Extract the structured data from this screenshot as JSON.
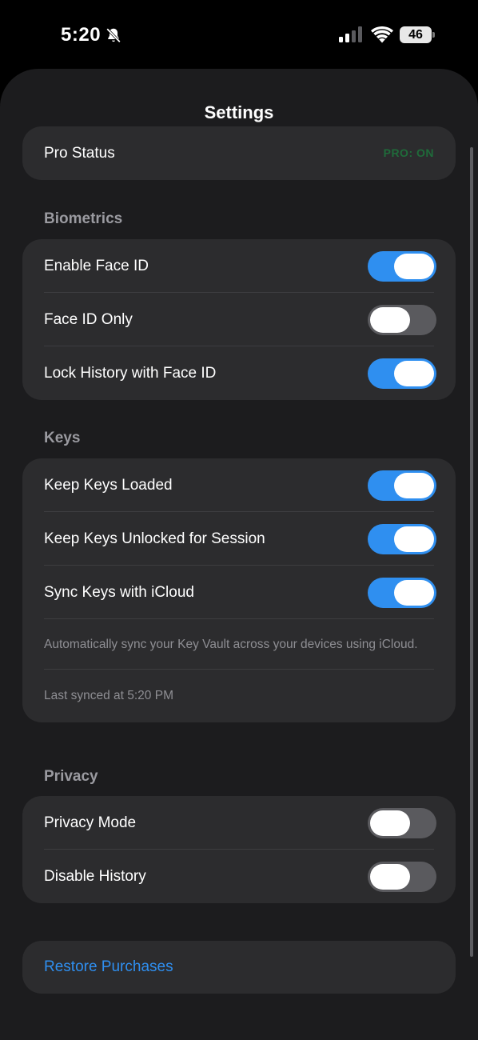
{
  "status_bar": {
    "time": "5:20",
    "battery": "46",
    "icons": [
      "bell-slash-icon",
      "cellular-signal-icon",
      "wifi-icon",
      "battery-icon"
    ]
  },
  "title": "Settings",
  "pro": {
    "label": "Pro Status",
    "value": "PRO: ON"
  },
  "sections": {
    "biometrics": {
      "header": "Biometrics",
      "rows": [
        {
          "label": "Enable Face ID",
          "on": true
        },
        {
          "label": "Face ID Only",
          "on": false
        },
        {
          "label": "Lock History with Face ID",
          "on": true
        }
      ]
    },
    "keys": {
      "header": "Keys",
      "rows": [
        {
          "label": "Keep Keys Loaded",
          "on": true
        },
        {
          "label": "Keep Keys Unlocked for Session",
          "on": true
        },
        {
          "label": "Sync Keys with iCloud",
          "on": true
        }
      ],
      "footnote": "Automatically sync your Key Vault across your devices using iCloud.",
      "last_synced": "Last synced at 5:20 PM"
    },
    "privacy": {
      "header": "Privacy",
      "rows": [
        {
          "label": "Privacy Mode",
          "on": false
        },
        {
          "label": "Disable History",
          "on": false
        }
      ]
    }
  },
  "restore_label": "Restore Purchases",
  "colors": {
    "accent": "#2f8ff0",
    "toggle_off": "#5a5a5e",
    "pro_green": "#1f6b3a",
    "card": "#2c2c2e",
    "background": "#1c1c1e"
  }
}
